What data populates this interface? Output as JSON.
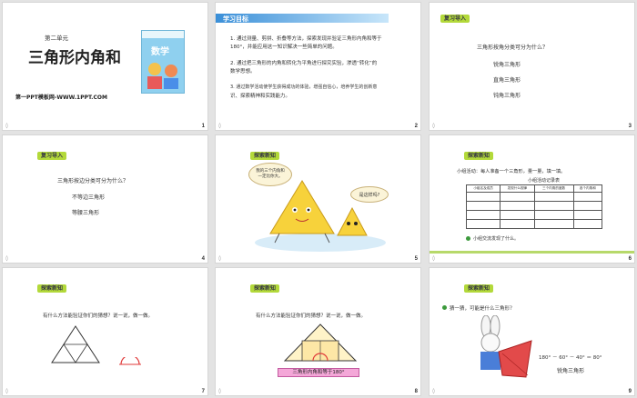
{
  "slides": [
    {
      "number": "1",
      "unit": "第二单元",
      "title": "三角形内角和",
      "footer": "第一PPT模板网-WWW.1PPT.COM",
      "book_title": "数学"
    },
    {
      "number": "2",
      "heading": "学习目标",
      "items": [
        "1. 通过测量、剪拼、折叠等方法，探索发现并验证三角形内角和等于",
        "180°，并能应用这一知识解决一些简单的问题。",
        "2. 通过把三角形的内角和转化为平角进行探究实验，渗透“转化”的",
        "数学思想。",
        "3. 通过数学活动使学生获得成功的体验，增强自信心，培养学生的创新意",
        "识、探索精神和实践能力。"
      ]
    },
    {
      "number": "3",
      "tag": "复习导入",
      "question": "三角形按角分类可分为什么？",
      "answers": [
        "锐角三角形",
        "直角三角形",
        "钝角三角形"
      ]
    },
    {
      "number": "4",
      "tag": "复习导入",
      "question": "三角形按边分类可分为什么？",
      "answers": [
        "不等边三角形",
        "等腰三角形"
      ]
    },
    {
      "number": "5",
      "tag": "探索新知",
      "bubble1": "我的三个内角和一定比你大。",
      "bubble2": "是这样吗?"
    },
    {
      "number": "6",
      "tag": "探索新知",
      "activity": "小组活动：每人准备一个三角形，量一量，填一填。",
      "table_title": "小组活动记录表",
      "table_headers": [
        "小组名及成员",
        "发现什么规律",
        "三个内角的度数",
        "各个内角和"
      ],
      "conclusion": "小组交流发现了什么。"
    },
    {
      "number": "7",
      "tag": "探索新知",
      "question": "有什么方法能验证你们的猜想？说一说，做一做。"
    },
    {
      "number": "8",
      "tag": "探索新知",
      "question": "有什么方法能验证你们的猜想？说一说，做一做。",
      "result": "三角形内角和等于180°"
    },
    {
      "number": "9",
      "tag": "探索新知",
      "prompt": "猜一猜，可能是什么三角形？",
      "equation": "180° － 60° － 40° ＝ 80°",
      "answer": "锐角三角形"
    }
  ]
}
